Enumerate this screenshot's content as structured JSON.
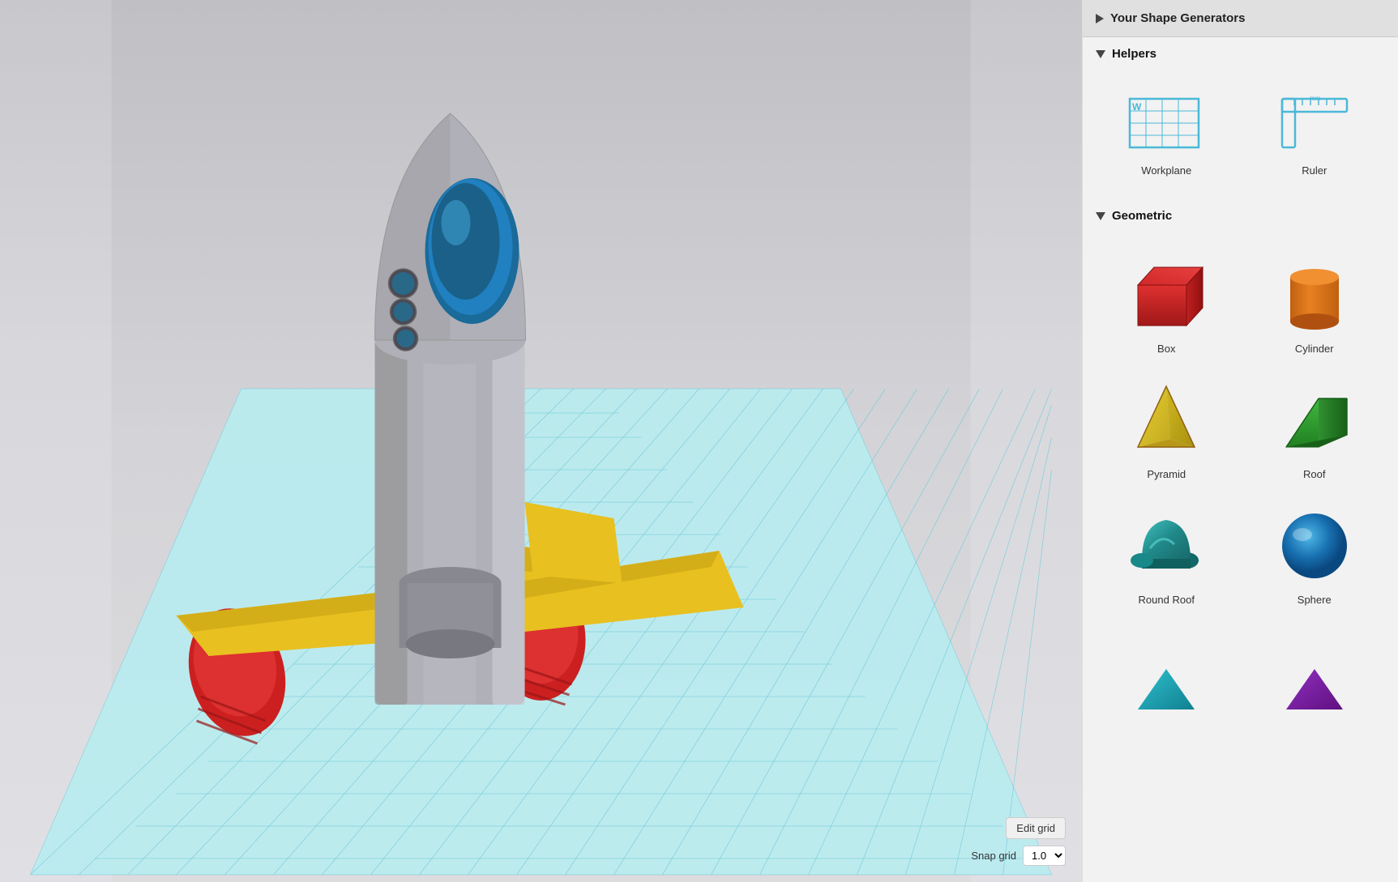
{
  "viewport": {
    "snap_grid_label": "Snap grid",
    "snap_grid_value": "1.0",
    "edit_grid_label": "Edit grid"
  },
  "sidebar": {
    "shape_generators_title": "Your Shape Generators",
    "helpers_title": "Helpers",
    "geometric_title": "Geometric",
    "helpers": [
      {
        "id": "workplane",
        "label": "Workplane"
      },
      {
        "id": "ruler",
        "label": "Ruler"
      }
    ],
    "shapes": [
      {
        "id": "box",
        "label": "Box"
      },
      {
        "id": "cylinder",
        "label": "Cylinder"
      },
      {
        "id": "pyramid",
        "label": "Pyramid"
      },
      {
        "id": "roof",
        "label": "Roof"
      },
      {
        "id": "round-roof",
        "label": "Round Roof"
      },
      {
        "id": "sphere",
        "label": "Sphere"
      }
    ]
  }
}
